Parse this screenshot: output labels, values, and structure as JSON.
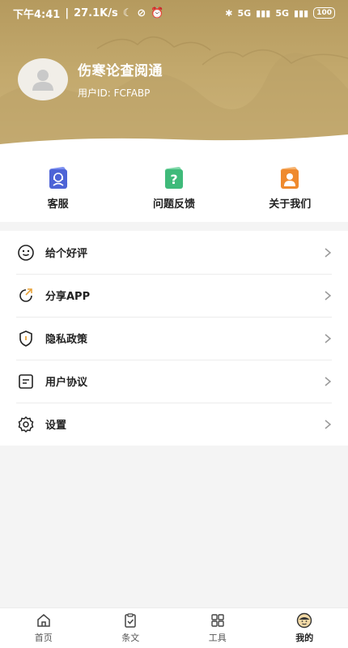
{
  "status_bar": {
    "time": "下午4:41",
    "speed": "27.1K/s",
    "network": "5G",
    "network2": "5G",
    "battery": "100"
  },
  "profile": {
    "app_name": "伤寒论查阅通",
    "user_id": "用户ID: FCFABP"
  },
  "quick_actions": [
    {
      "label": "客服",
      "icon": "customer-service-icon",
      "color": "#4d63d6"
    },
    {
      "label": "问题反馈",
      "icon": "question-icon",
      "color": "#3fba7a"
    },
    {
      "label": "关于我们",
      "icon": "about-us-icon",
      "color": "#ef8a2e"
    }
  ],
  "menu": [
    {
      "label": "给个好评",
      "icon": "smile-icon"
    },
    {
      "label": "分享APP",
      "icon": "share-icon"
    },
    {
      "label": "隐私政策",
      "icon": "shield-icon"
    },
    {
      "label": "用户协议",
      "icon": "document-icon"
    },
    {
      "label": "设置",
      "icon": "gear-icon"
    }
  ],
  "bottom_nav": [
    {
      "label": "首页",
      "icon": "home-icon"
    },
    {
      "label": "条文",
      "icon": "clipboard-check-icon"
    },
    {
      "label": "工具",
      "icon": "grid-icon"
    },
    {
      "label": "我的",
      "icon": "profile-face-icon",
      "active": true
    }
  ],
  "colors": {
    "header": "#c2a86c",
    "accent_blue": "#4d63d6",
    "accent_green": "#3fba7a",
    "accent_orange": "#ef8a2e"
  }
}
